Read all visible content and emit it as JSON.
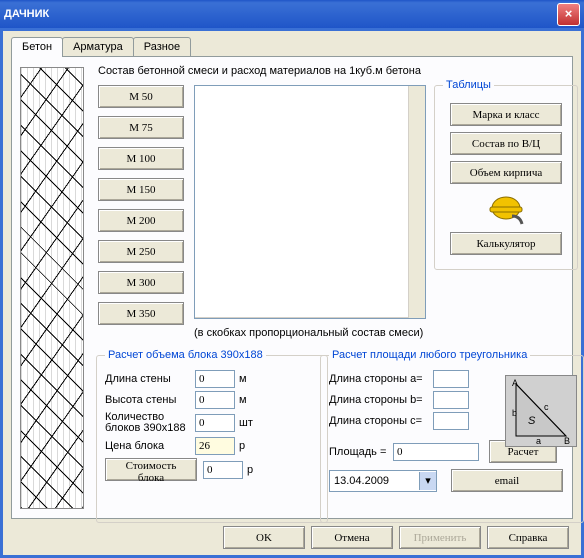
{
  "title": "ДАЧНИК",
  "tabs": [
    "Бетон",
    "Арматура",
    "Разное"
  ],
  "heading": "Состав бетонной смеси и расход материалов на 1куб.м бетона",
  "grades": [
    "М 50",
    "М 75",
    "М 100",
    "М 150",
    "М 200",
    "М 250",
    "М 300",
    "М 350"
  ],
  "note": "(в скобках пропорциональный состав смеси)",
  "tables": {
    "legend": "Таблицы",
    "mark": "Марка и класс",
    "wc": "Состав по В/Ц",
    "brick": "Объем кирпича",
    "calc": "Калькулятор"
  },
  "block": {
    "legend": "Расчет объема блока 390х188",
    "wall_len": "Длина стены",
    "wall_h": "Высота стены",
    "qty": "Количество блоков 390х188",
    "price": "Цена блока",
    "cost": "Стоимость блока",
    "m": "м",
    "pcs": "шт",
    "rub": "р",
    "v": {
      "len": "0",
      "h": "0",
      "qty": "0",
      "price": "26",
      "cost": "0"
    }
  },
  "tri": {
    "legend": "Расчет площади любого треугольника",
    "a": "Длина стороны a=",
    "b": "Длина стороны b=",
    "c": "Длина стороны c=",
    "area": "Площадь =",
    "calc": "Расчет",
    "v": {
      "a": "",
      "b": "",
      "c": "",
      "area": "0"
    },
    "fig": {
      "A": "A",
      "B": "B",
      "a": "a",
      "b": "b",
      "c": "c",
      "S": "S"
    }
  },
  "date": "13.04.2009",
  "email": "email",
  "footer": {
    "ok": "OK",
    "cancel": "Отмена",
    "apply": "Применить",
    "help": "Справка"
  }
}
